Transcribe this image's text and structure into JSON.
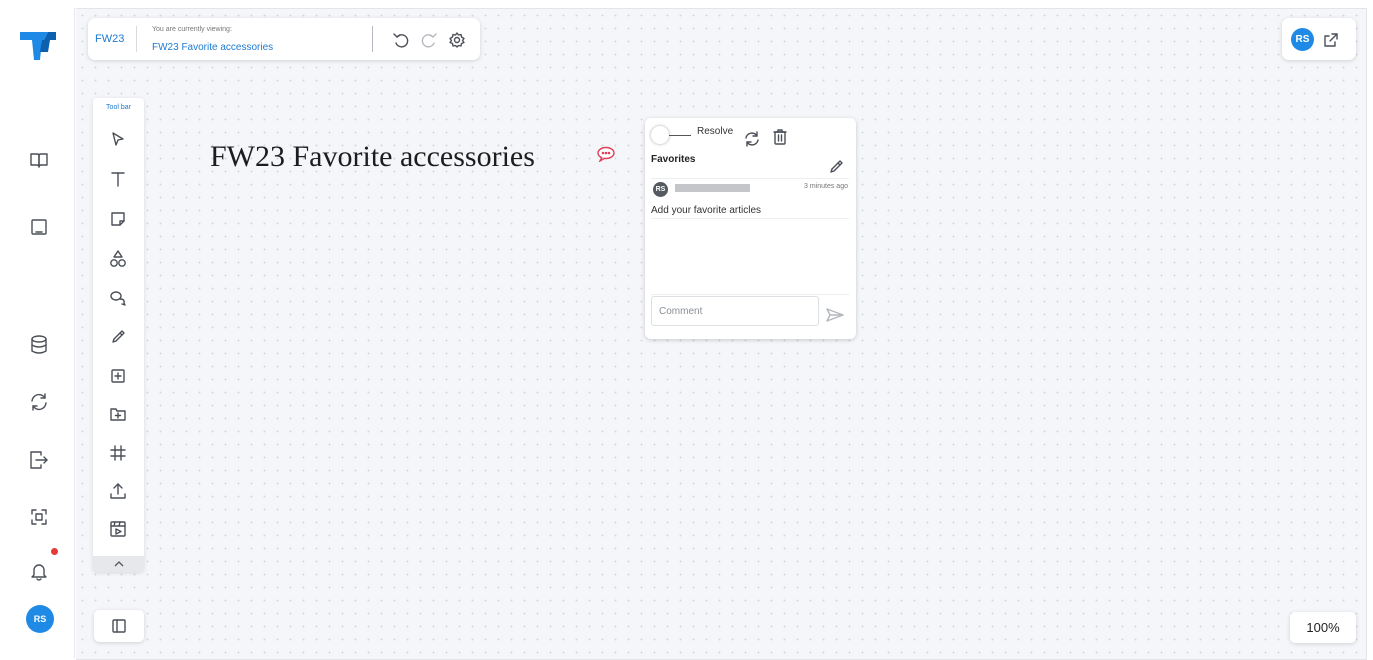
{
  "app": {
    "brand_color": "#1f8ae6"
  },
  "header": {
    "project": "FW23",
    "viewing_label": "You are currently viewing:",
    "board_name": "FW23 Favorite accessories"
  },
  "user": {
    "initials": "RS"
  },
  "toolbar": {
    "label": "Tool bar"
  },
  "canvas": {
    "title": "FW23 Favorite accessories"
  },
  "comment_card": {
    "resolve_label": "Resolve",
    "title": "Favorites",
    "comments": [
      {
        "author_initials": "RS",
        "time": "3 minutes ago",
        "text": "Add your favorite articles"
      }
    ],
    "input_placeholder": "Comment"
  },
  "zoom": {
    "level": "100%"
  }
}
